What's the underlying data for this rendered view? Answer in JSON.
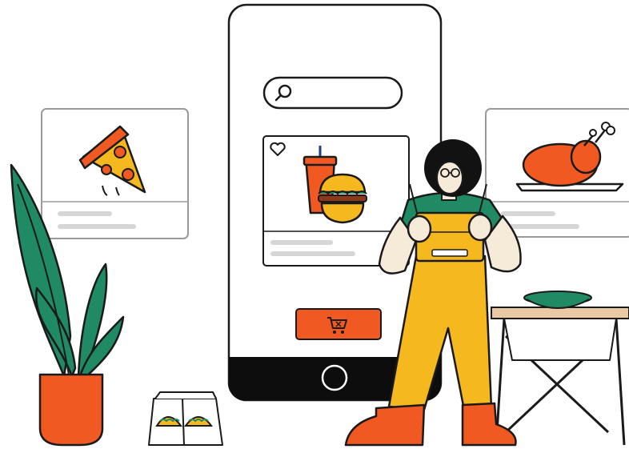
{
  "illustration": {
    "search": {
      "placeholder": ""
    },
    "icons": [
      "search-icon",
      "heart-icon",
      "cart-icon",
      "home-button-icon"
    ],
    "colors": {
      "outline": "#1a1a1a",
      "accent_orange": "#f05a22",
      "yellow": "#f5b81f",
      "green": "#1f8a64",
      "card_border": "#9a9a9a",
      "line_gray": "#d6d6d6",
      "table_wood": "#e8c9a4",
      "skin": "#f6ead8",
      "hair": "#121212"
    }
  }
}
